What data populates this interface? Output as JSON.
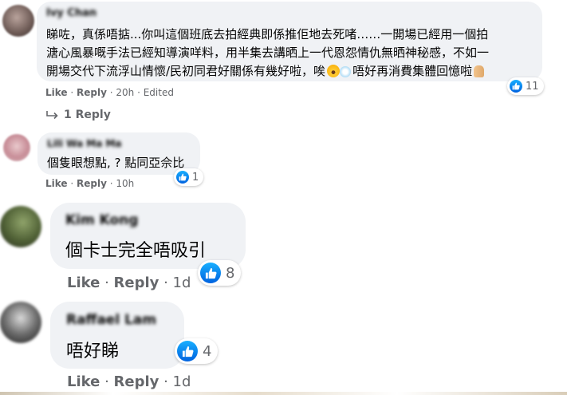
{
  "comments": [
    {
      "author": "Ivy Chan",
      "lines": [
        "睇咗，真係唔掂...你叫這個班底去拍經典即係推佢地去死啫……一開場已經用一個拍",
        "溏心風暴嘅手法已經知導演咩料，用半集去講晒上一代恩怨情仇無晒神秘感，不如一",
        "開場交代下流浮山情懷/民初同君好關係有幾好啦，唉",
        "唔好再消費集體回憶啦"
      ],
      "like": "Like",
      "reply": "Reply",
      "time": "20h",
      "edited": "Edited",
      "reactions": "11",
      "replies_label": "1 Reply"
    },
    {
      "author": "Lili Wa Ma Ma",
      "lines": [
        "個隻眼想點, ? 點同亞佘比"
      ],
      "like": "Like",
      "reply": "Reply",
      "time": "10h",
      "reactions": "1"
    },
    {
      "author": "Kim Kong",
      "lines": [
        "個卡士完全唔吸引"
      ],
      "like": "Like",
      "reply": "Reply",
      "time": "1d",
      "reactions": "8"
    },
    {
      "author": "Raffael Lam",
      "lines": [
        "唔好睇"
      ],
      "like": "Like",
      "reply": "Reply",
      "time": "1d",
      "reactions": "4"
    }
  ],
  "icons": {
    "like": "like-thumb-icon",
    "reply_arrow": "reply-arrow-icon",
    "face": "astonished-face-emoji",
    "dash": "dash-emoji",
    "pray": "pray-emoji"
  },
  "colors": {
    "bubble": "#f0f2f5",
    "meta": "#65676b",
    "like_blue": "#1877f2"
  }
}
